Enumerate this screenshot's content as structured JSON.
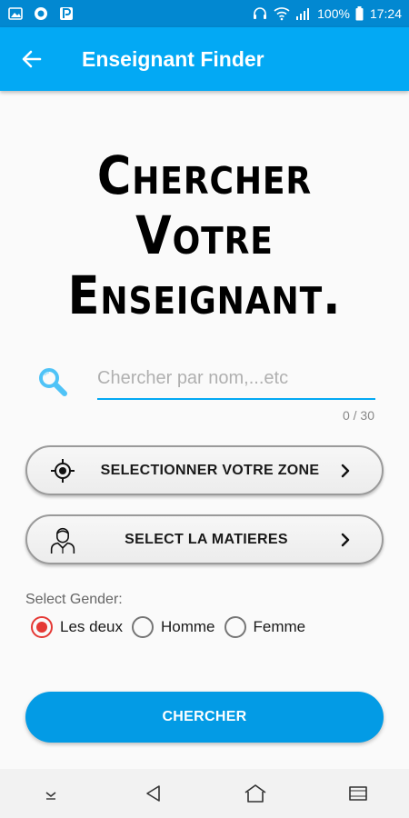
{
  "status_bar": {
    "battery": "100%",
    "time": "17:24",
    "icons": [
      "image-icon",
      "circle-app-icon",
      "p-app-icon",
      "headset-icon",
      "wifi-icon",
      "signal-icon",
      "battery-icon"
    ]
  },
  "app_bar": {
    "title": "Enseignant Finder",
    "back_icon": "arrow-left-icon"
  },
  "hero": {
    "lines": [
      "Chercher",
      "Votre",
      "Enseignant."
    ]
  },
  "search": {
    "placeholder": "Chercher par nom,...etc",
    "value": "",
    "counter": "0 / 30",
    "icon": "search-icon"
  },
  "buttons": {
    "zone_label": "SELECTIONNER VOTRE ZONE",
    "matiere_label": "SELECT LA MATIERES",
    "submit_label": "CHERCHER"
  },
  "gender": {
    "label": "Select Gender:",
    "options": [
      "Les deux",
      "Homme",
      "Femme"
    ],
    "selected": "Les deux"
  },
  "colors": {
    "status_bar": "#0288d1",
    "app_bar": "#03a9f4",
    "accent": "#039be5",
    "radio_checked": "#e53935"
  }
}
